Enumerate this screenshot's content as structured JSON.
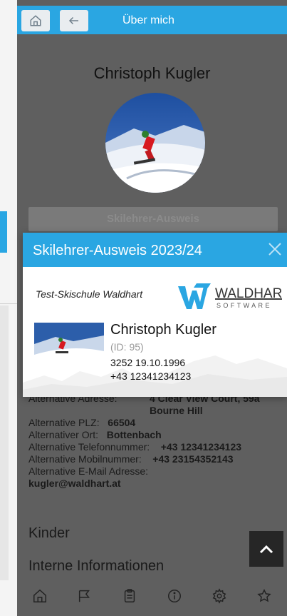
{
  "header": {
    "title": "Über mich"
  },
  "profile": {
    "name": "Christoph Kugler"
  },
  "ausweis_button": "Skilehrer-Ausweis",
  "modal": {
    "title": "Skilehrer-Ausweis 2023/24",
    "school": "Test-Skischule Waldhart",
    "logo_main": "WALDHART",
    "logo_sub": "SOFTWARE",
    "card_name": "Christoph Kugler",
    "card_id": "(ID: 95)",
    "card_number": "3252",
    "card_birthdate": "19.10.1996",
    "card_phone": "+43 12341234123"
  },
  "details": {
    "alt_address_label": "Alternative Adresse:",
    "alt_address_value_1": "4 Clear View Court, 59a",
    "alt_address_value_2": "Bourne Hill",
    "alt_zip_label": "Alternative PLZ:",
    "alt_zip_value": "66504",
    "alt_city_label": "Alternativer Ort:",
    "alt_city_value": "Bottenbach",
    "alt_phone_label": "Alternative Telefonnummer:",
    "alt_phone_value": "+43 12341234123",
    "alt_mobile_label": "Alternative Mobilnummer:",
    "alt_mobile_value": "+43 23154352143",
    "alt_email_label": "Alternative E-Mail Adresse:",
    "alt_email_value": "kugler@waldhart.at"
  },
  "sections": {
    "kinder": "Kinder",
    "intern": "Interne Informationen"
  },
  "nav_icons": [
    "home-icon",
    "flag-icon",
    "clipboard-icon",
    "info-icon",
    "settings-icon",
    "star-icon"
  ],
  "colors": {
    "accent": "#2aa6e2",
    "overlay": "#5f5f5f"
  }
}
